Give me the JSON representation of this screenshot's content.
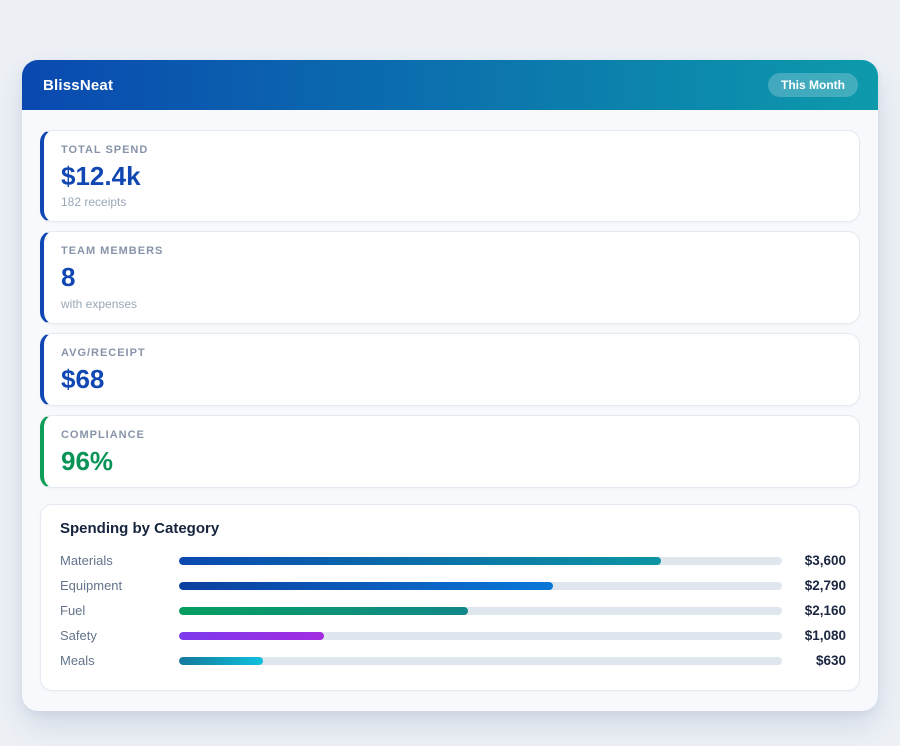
{
  "header": {
    "title": "BlissNeat",
    "period_badge": "This Month"
  },
  "stats": [
    {
      "label": "TOTAL SPEND",
      "value": "$12.4k",
      "sub": "182 receipts",
      "accent": "#1147b2",
      "value_color": "#1147b2"
    },
    {
      "label": "TEAM MEMBERS",
      "value": "8",
      "sub": "with expenses",
      "accent": "#1147b2",
      "value_color": "#1147b2"
    },
    {
      "label": "AVG/RECEIPT",
      "value": "$68",
      "sub": "",
      "accent": "#1147b2",
      "value_color": "#1147b2"
    },
    {
      "label": "COMPLIANCE",
      "value": "96%",
      "sub": "",
      "accent": "#0f9d58",
      "value_color": "#0a9357"
    }
  ],
  "spending": {
    "title": "Spending by Category"
  },
  "chart_data": {
    "type": "bar",
    "orientation": "horizontal",
    "title": "Spending by Category",
    "categories": [
      "Materials",
      "Equipment",
      "Fuel",
      "Safety",
      "Meals"
    ],
    "values": [
      3600,
      2790,
      2160,
      1080,
      630
    ],
    "value_labels": [
      "$3,600",
      "$2,790",
      "$2,160",
      "$1,080",
      "$630"
    ],
    "xlim": [
      0,
      4500
    ],
    "track_color": "#e0e6ee",
    "bar_colors": [
      [
        "#0a49b0",
        "#0c95a2"
      ],
      [
        "#0c3f9e",
        "#0a78d8"
      ],
      [
        "#069e60",
        "#12888a"
      ],
      [
        "#7c3aed",
        "#a22ce0"
      ],
      [
        "#14799c",
        "#0ec0dd"
      ]
    ]
  },
  "colors": {
    "page_bg": "#edf1f6",
    "container_bg": "#f7f9fc",
    "header_gradient_from": "#0a49b0",
    "header_gradient_to": "#0d9aab"
  }
}
